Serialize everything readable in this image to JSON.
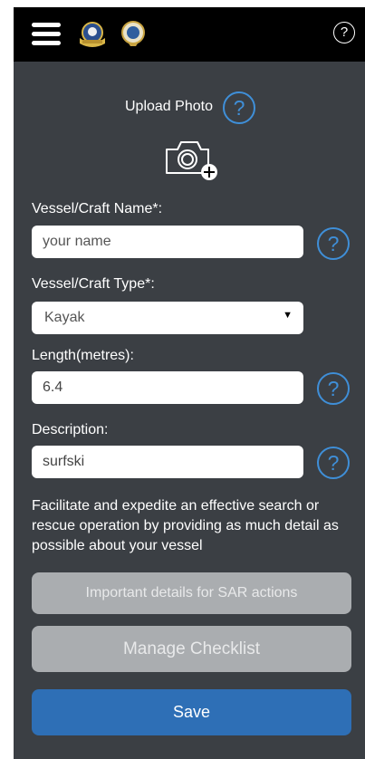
{
  "header": {
    "menu_icon": "hamburger-menu-icon",
    "logos": [
      "coast-guard-emblem",
      "round-seal-emblem"
    ],
    "help_glyph": "?"
  },
  "upload": {
    "label": "Upload Photo",
    "icon": "camera-add-icon"
  },
  "form": {
    "name_label": "Vessel/Craft Name*:",
    "name_placeholder": "your name",
    "type_label": "Vessel/Craft Type*:",
    "type_value": "Kayak",
    "length_label": "Length(metres):",
    "length_value": "6.4",
    "description_label": "Description:",
    "description_value": "surfski",
    "help_glyph": "?"
  },
  "info_text": "Facilitate and expedite an effective search or rescue operation by providing as much detail as possible about your vessel",
  "buttons": {
    "sar": "Important details for SAR actions",
    "checklist": "Manage Checklist",
    "save": "Save"
  },
  "colors": {
    "background": "#3b3f44",
    "topbar": "#000000",
    "accent": "#3f8fd8",
    "save": "#2e6fb6",
    "disabled_button": "#aaadb0"
  }
}
